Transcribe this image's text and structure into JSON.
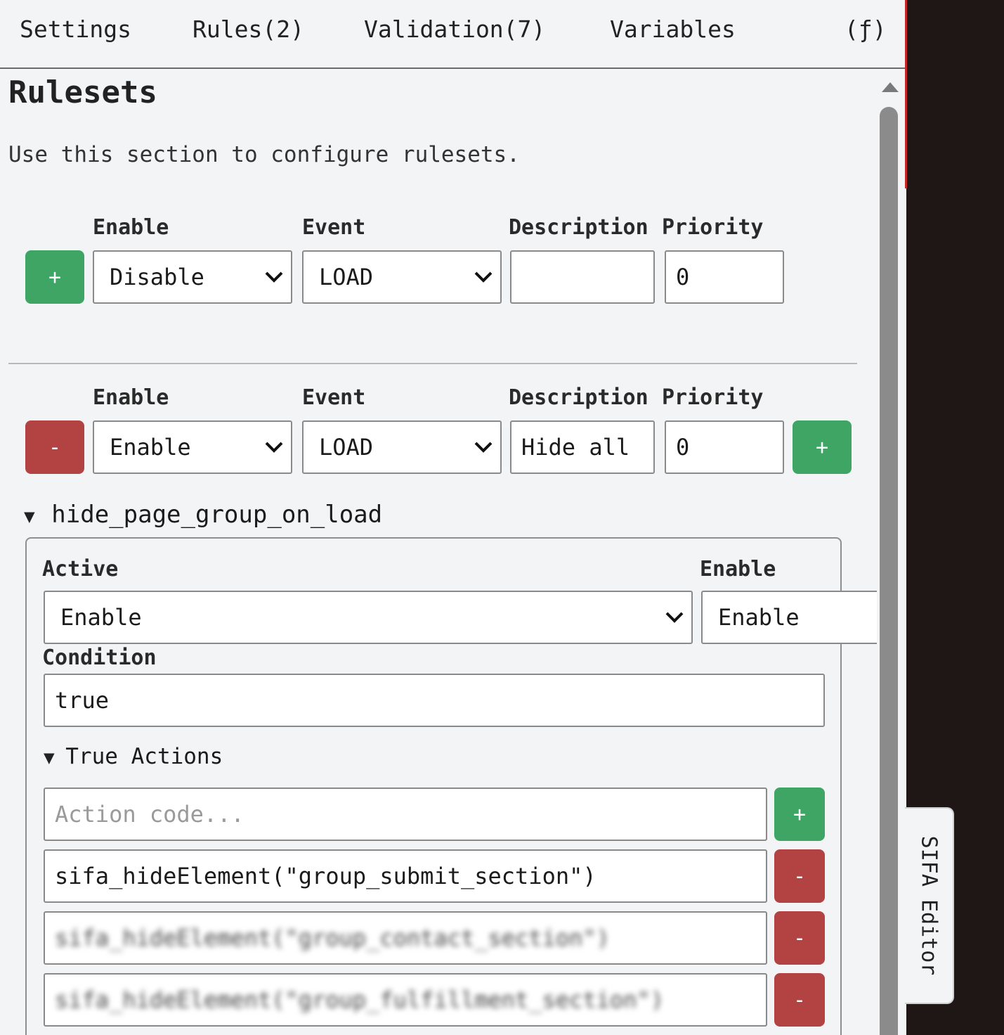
{
  "tabs": [
    {
      "label": "Settings"
    },
    {
      "label": "Rules(2)"
    },
    {
      "label": "Validation(7)"
    },
    {
      "label": "Variables"
    },
    {
      "label": "(ƒ)"
    }
  ],
  "rulesets": {
    "title": "Rulesets",
    "description": "Use this section to configure rulesets.",
    "labels": {
      "enable": "Enable",
      "event": "Event",
      "description": "Description",
      "priority": "Priority"
    },
    "add_row": {
      "add_label": "+",
      "enable": "Disable",
      "event": "LOAD",
      "description": "",
      "priority": "0"
    },
    "ruleset_1": {
      "remove_label": "-",
      "add_label": "+",
      "enable": "Enable",
      "event": "LOAD",
      "description": "Hide all",
      "priority": "0",
      "collapse_icon": "▼",
      "name": "hide_page_group_on_load",
      "rule": {
        "active_label": "Active",
        "active_value": "Enable",
        "enable_label": "Enable",
        "enable_value": "Enable",
        "condition_label": "Condition",
        "condition_value": "true",
        "true_actions": {
          "collapse_icon": "▼",
          "label": "True Actions",
          "new_action_placeholder": "Action code...",
          "add_label": "+",
          "remove_label": "-",
          "actions": [
            "sifa_hideElement(\"group_submit_section\")",
            "sifa_hideElement(\"group_contact_section\")",
            "sifa_hideElement(\"group_fulfillment_section\")"
          ]
        }
      }
    }
  },
  "side_tab": {
    "label": "SIFA Editor"
  },
  "colors": {
    "add": "#3fa565",
    "remove": "#b34343",
    "accent": "#c62828",
    "outer_bg": "#1f1715"
  }
}
